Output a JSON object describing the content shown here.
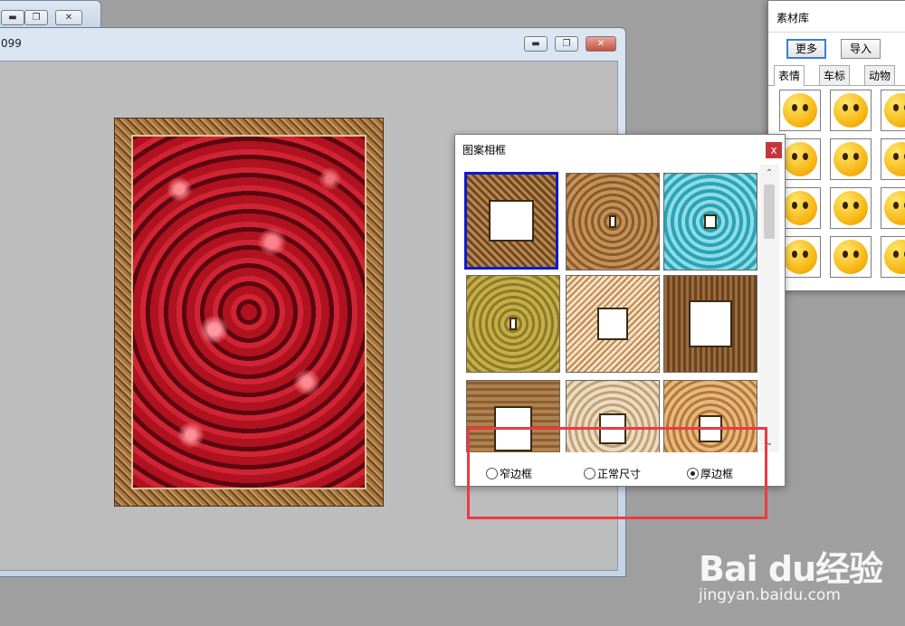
{
  "back_window": {
    "controls": [
      "minimize",
      "restore",
      "close"
    ]
  },
  "main_window": {
    "title": "099"
  },
  "material_library": {
    "title": "素材库",
    "buttons": {
      "more": "更多",
      "import": "导入"
    },
    "tabs": [
      "表情",
      "车标",
      "动物"
    ],
    "active_tab": "表情"
  },
  "pattern_frame_dialog": {
    "title": "图案相框",
    "close_label": "x",
    "selected_index": 0,
    "radio_options": [
      {
        "label": "窄边框",
        "checked": false
      },
      {
        "label": "正常尺寸",
        "checked": false
      },
      {
        "label": "厚边框",
        "checked": true
      }
    ]
  },
  "watermark": {
    "logo": "Bai du经验",
    "url": "jingyan.baidu.com"
  },
  "colors": {
    "highlight": "#ea3b44",
    "selection": "#0b1bd0"
  }
}
